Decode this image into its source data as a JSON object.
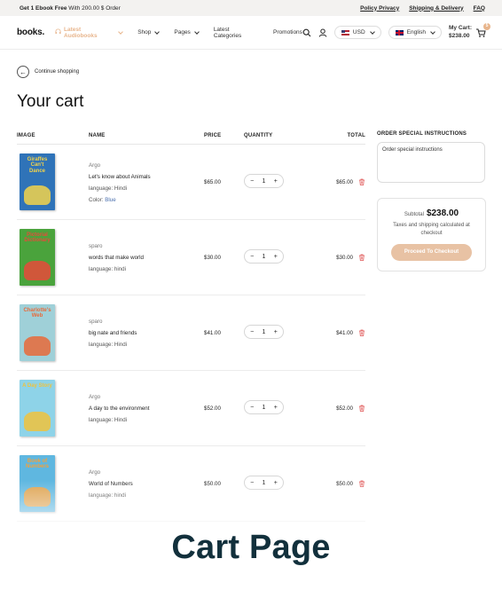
{
  "topbar": {
    "promo_bold": "Get 1 Ebook Free",
    "promo_rest": "With 200.00 $ Order",
    "links": [
      "Policy Privacy",
      "Shipping & Delivery",
      "FAQ"
    ]
  },
  "header": {
    "logo": "books.",
    "nav": [
      {
        "label": "Latest Audiobooks",
        "dropdown": true,
        "active": true
      },
      {
        "label": "Shop",
        "dropdown": true,
        "active": false
      },
      {
        "label": "Pages",
        "dropdown": true,
        "active": false
      },
      {
        "label": "Latest Categories",
        "dropdown": false,
        "active": false
      },
      {
        "label": "Promotions",
        "dropdown": false,
        "active": false
      }
    ],
    "currency": "USD",
    "language": "English",
    "cart_label": "My Cart:",
    "cart_total": "$238.00",
    "cart_count": "5",
    "accent": "#e8b58c"
  },
  "cart": {
    "continue_label": "Continue shopping",
    "title": "Your cart",
    "columns": [
      "IMAGE",
      "NAME",
      "PRICE",
      "QUANTITY",
      "TOTAL"
    ],
    "items": [
      {
        "cover_title": "Giraffes Can't Dance",
        "vendor": "Argo",
        "title": "Let's know about Animals",
        "language_label": "language:",
        "language": "Hindi",
        "color_label": "Color:",
        "color": "Blue",
        "price": "$65.00",
        "qty": "1",
        "total": "$65.00",
        "cover_color": "#2f73b8",
        "cover_accent": "#f2d34a"
      },
      {
        "cover_title": "Pictorial Dictionary",
        "vendor": "sparo",
        "title": "words that make world",
        "language_label": "language:",
        "language": "hindi",
        "price": "$30.00",
        "qty": "1",
        "total": "$30.00",
        "cover_color": "#4aa33c",
        "cover_accent": "#e84a3a"
      },
      {
        "cover_title": "Charlotte's Web",
        "vendor": "sparo",
        "title": "big nate and friends",
        "language_label": "language:",
        "language": "Hindi",
        "price": "$41.00",
        "qty": "1",
        "total": "$41.00",
        "cover_color": "#9fd0d8",
        "cover_accent": "#e86a3a"
      },
      {
        "cover_title": "A Day Story",
        "vendor": "Argo",
        "title": "A day to the environment",
        "language_label": "language:",
        "language": "Hindi",
        "price": "$52.00",
        "qty": "1",
        "total": "$52.00",
        "cover_color": "#8ed3e8",
        "cover_accent": "#f0c23c"
      },
      {
        "cover_title": "Book of Numbers",
        "vendor": "Argo",
        "title": "World of Numbers",
        "language_label": "language:",
        "language": "hindi",
        "price": "$50.00",
        "qty": "1",
        "total": "$50.00",
        "cover_color": "#5fb7e0",
        "cover_accent": "#f4a13a"
      }
    ]
  },
  "sidebar": {
    "instructions_label": "ORDER SPECIAL INSTRUCTIONS",
    "instructions_placeholder": "Order special instructions",
    "subtotal_label": "Subtotal",
    "subtotal_value": "$238.00",
    "tax_note": "Taxes and shipping calculated at checkout",
    "checkout_label": "Proceed To Checkout"
  },
  "caption": "Cart Page"
}
